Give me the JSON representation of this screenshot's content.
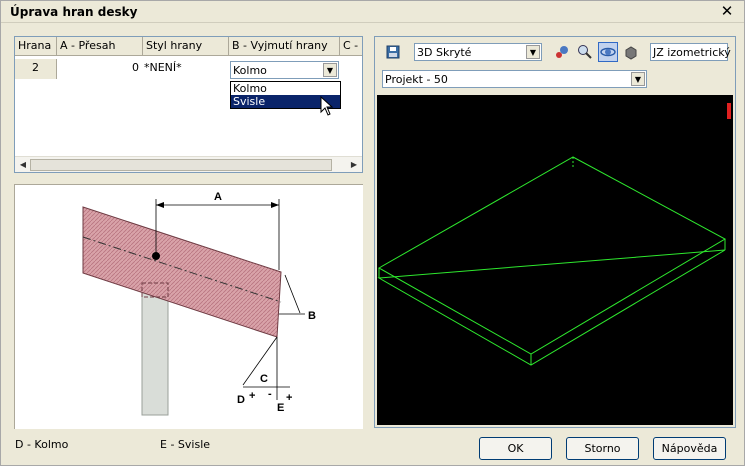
{
  "window": {
    "title": "Úprava hran desky"
  },
  "grid": {
    "columns": [
      "Hrana",
      "A - Přesah",
      "Styl hrany",
      "B - Vyjmutí hrany",
      "C -"
    ],
    "rows": [
      {
        "edge": "2",
        "offset": "0",
        "style": "*NENÍ*",
        "cut": "Kolmo"
      }
    ],
    "dropdown_options": [
      "Kolmo",
      "Svisle"
    ],
    "selected_option": "Svisle"
  },
  "illustration": {
    "labels": {
      "a": "A",
      "b": "B",
      "c": "C",
      "d": "D",
      "e": "E"
    }
  },
  "legend": {
    "d": "D - Kolmo",
    "e": "E - Svisle"
  },
  "preview": {
    "view_mode": "3D Skryté",
    "view_direction": "JZ izometrický",
    "project": "Projekt - 50",
    "icons": [
      "save-icon",
      "pan-icon",
      "zoom-icon",
      "orbit-icon",
      "view-cube-icon"
    ]
  },
  "buttons": {
    "ok": "OK",
    "cancel": "Storno",
    "help": "Nápověda"
  }
}
